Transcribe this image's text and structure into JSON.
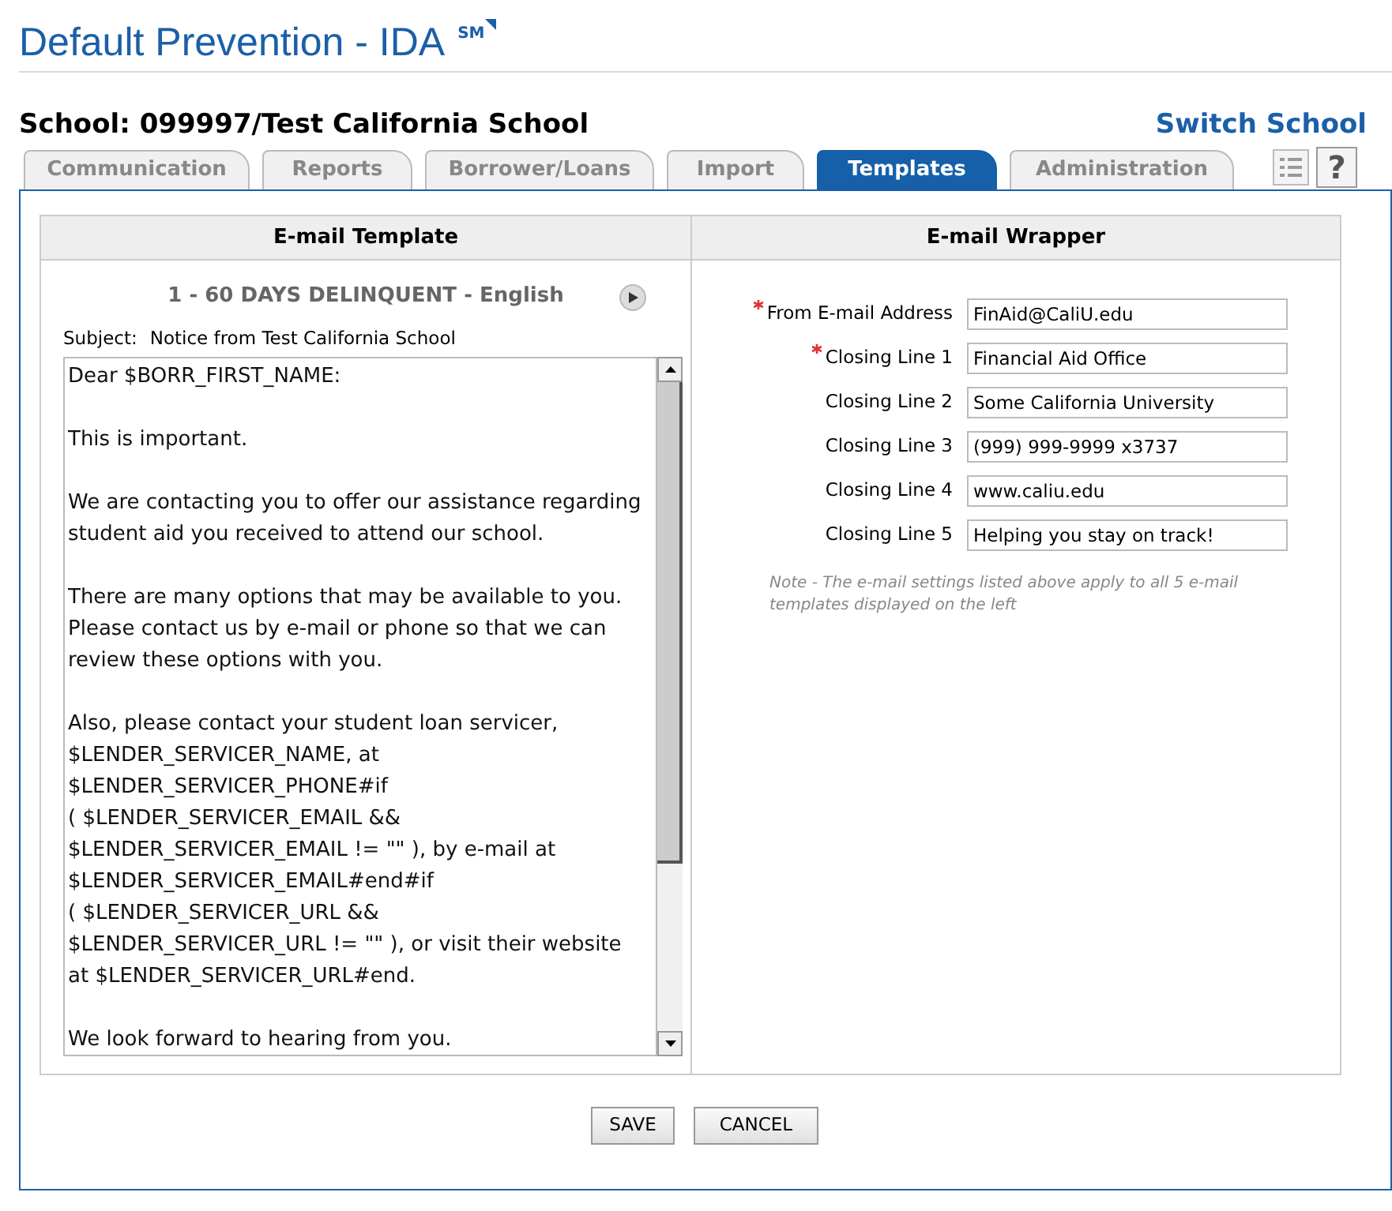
{
  "app": {
    "title": "Default Prevention - IDA",
    "mark": "SM"
  },
  "school": {
    "label": "School: 099997/Test California School",
    "switch_link": "Switch School"
  },
  "tabs": [
    {
      "label": "Communication",
      "selected": false
    },
    {
      "label": "Reports",
      "selected": false
    },
    {
      "label": "Borrower/Loans",
      "selected": false
    },
    {
      "label": "Import",
      "selected": false
    },
    {
      "label": "Templates",
      "selected": true
    },
    {
      "label": "Administration",
      "selected": false
    }
  ],
  "help_button": "?",
  "template_panel": {
    "heading": "E-mail Template",
    "template_name": "1 - 60 DAYS DELINQUENT - English",
    "subject_label": "Subject:",
    "subject": "Notice from Test California School",
    "body": [
      [
        "Dear $BORR_FIRST_NAME:"
      ],
      [
        "This is important."
      ],
      [
        "We are contacting you to offer our assistance regarding",
        "student aid you received to attend our school."
      ],
      [
        "There are many options that may be available to you.",
        "Please contact us by e-mail or phone so that we can",
        "review these options with you."
      ],
      [
        "Also, please contact your student loan servicer,",
        "$LENDER_SERVICER_NAME, at",
        "$LENDER_SERVICER_PHONE#if",
        "( $LENDER_SERVICER_EMAIL &&",
        "$LENDER_SERVICER_EMAIL != \"\" ), by e-mail at",
        "$LENDER_SERVICER_EMAIL#end#if",
        "( $LENDER_SERVICER_URL &&",
        "$LENDER_SERVICER_URL != \"\" ), or visit their website",
        "at $LENDER_SERVICER_URL#end."
      ],
      [
        "We look forward to hearing from you."
      ]
    ]
  },
  "wrapper_panel": {
    "heading": "E-mail Wrapper",
    "fields": [
      {
        "label": "From E-mail Address",
        "value": "FinAid@CaliU.edu",
        "required": true
      },
      {
        "label": "Closing Line 1",
        "value": "Financial Aid Office",
        "required": true
      },
      {
        "label": "Closing Line 2",
        "value": "Some California University",
        "required": false
      },
      {
        "label": "Closing Line 3",
        "value": "(999) 999-9999 x3737",
        "required": false
      },
      {
        "label": "Closing Line 4",
        "value": "www.caliu.edu",
        "required": false
      },
      {
        "label": "Closing Line 5",
        "value": "Helping you stay on track!",
        "required": false
      }
    ],
    "note": "Note - The e-mail settings listed above apply to all 5 e-mail templates displayed on the left"
  },
  "buttons": [
    "SAVE",
    "CANCEL"
  ]
}
